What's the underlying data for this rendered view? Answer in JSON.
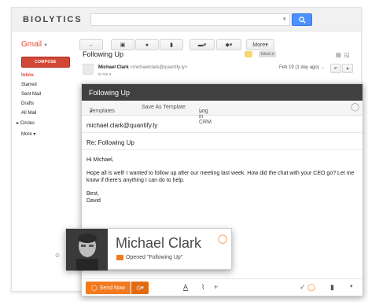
{
  "app": {
    "logo": "BIOLYTICS",
    "gmail_label": "Gmail"
  },
  "toolbar": {
    "more_label": "More"
  },
  "sidebar": {
    "compose_label": "COMPOSE",
    "items": [
      {
        "label": "Inbox"
      },
      {
        "label": "Starred"
      },
      {
        "label": "Sent Mail"
      },
      {
        "label": "Drafts"
      },
      {
        "label": "All Mail"
      },
      {
        "label": "Circles"
      },
      {
        "label": "More"
      }
    ]
  },
  "thread": {
    "subject": "Following Up",
    "inbox_tag": "Inbox",
    "x_tag": "x",
    "from_name": "Michael Clark",
    "from_email": "<michaelclark@quantify.ly>",
    "to": "to me",
    "date": "Feb 19 (1 day ago)"
  },
  "compose": {
    "title": "Following Up",
    "templates_label": "Templates",
    "save_template_label": "Save As Template",
    "log_crm_label": "Log in CRM",
    "to": "michael.clark@quantify.ly",
    "subject": "Re: Following Up",
    "greeting": "Hi Michael,",
    "body": "Hope all is well! I wanted to follow up after our meeting last week. How did the chat with your CEO go? Let me know if there's anything I can do to help.",
    "closing": "Best,",
    "signature": "David",
    "send_label": "Send Now"
  },
  "contact_card": {
    "name": "Michael Clark",
    "status": "Opened \"Following Up\""
  },
  "colors": {
    "accent": "#f27a1f",
    "gmail_red": "#dd4b39",
    "search_blue": "#4d90fe"
  }
}
